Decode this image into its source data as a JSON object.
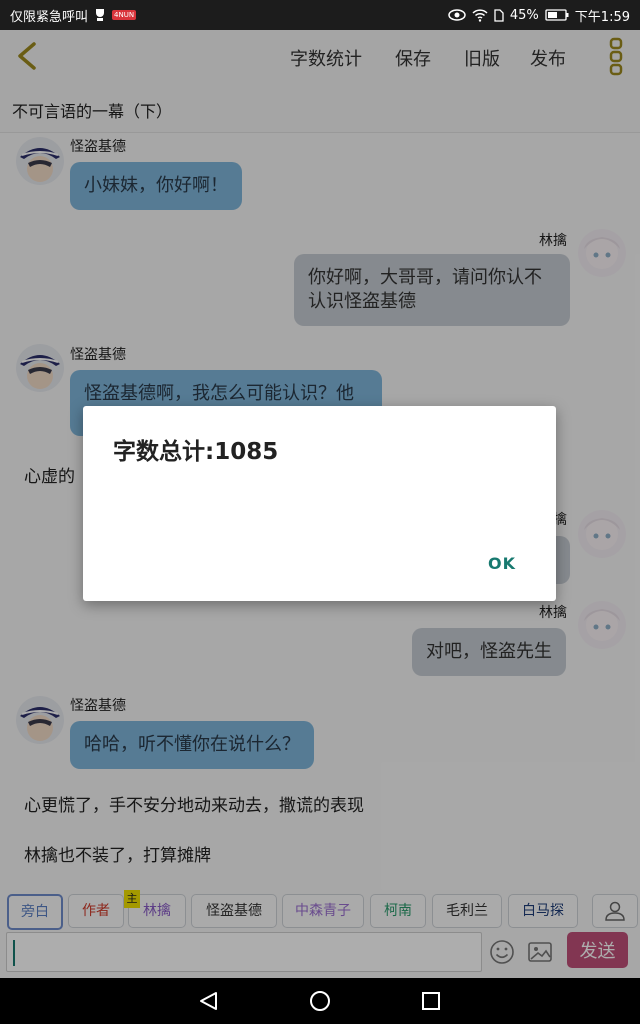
{
  "status_bar": {
    "left_text": "仅限紧急呼叫",
    "app_badge": "4NUN",
    "battery": "45%",
    "time": "下午1:59"
  },
  "toolbar": {
    "word_count": "字数统计",
    "save": "保存",
    "old_version": "旧版",
    "publish": "发布"
  },
  "doc_title": "不可言语的一幕（下）",
  "chat": {
    "m1_name": "怪盗基德",
    "m1_text": "小妹妹，你好啊！",
    "m2_name": "林擒",
    "m2_text_line1": "你好啊，大哥哥，请问你认不",
    "m2_text_line2": "认识怪盗基德",
    "m3_name": "怪盗基德",
    "m3_text": "怪盗基德啊，我怎么可能认识？他",
    "narr1": "心虚的",
    "m4_name": "林擒",
    "m5_name": "林擒",
    "m5_text": "对吧，怪盗先生",
    "m6_name": "怪盗基德",
    "m6_text": "哈哈，听不懂你在说什么？",
    "narr2": "心更慌了，手不安分地动来动去，撒谎的表现",
    "narr3": "林擒也不装了，打算摊牌"
  },
  "dialog": {
    "message": "字数总计:1085",
    "ok": "OK"
  },
  "roles": {
    "master_badge": "主",
    "items": [
      {
        "label": "旁白",
        "color": "#5a7fc4"
      },
      {
        "label": "作者",
        "color": "#d03a2a"
      },
      {
        "label": "林擒",
        "color": "#8a5cc7"
      },
      {
        "label": "怪盗基德",
        "color": "#333333"
      },
      {
        "label": "中森青子",
        "color": "#9b6fd1"
      },
      {
        "label": "柯南",
        "color": "#2a9b6c"
      },
      {
        "label": "毛利兰",
        "color": "#333333"
      },
      {
        "label": "白马探",
        "color": "#1e3d7a"
      }
    ]
  },
  "input": {
    "value": "",
    "send": "发送"
  }
}
